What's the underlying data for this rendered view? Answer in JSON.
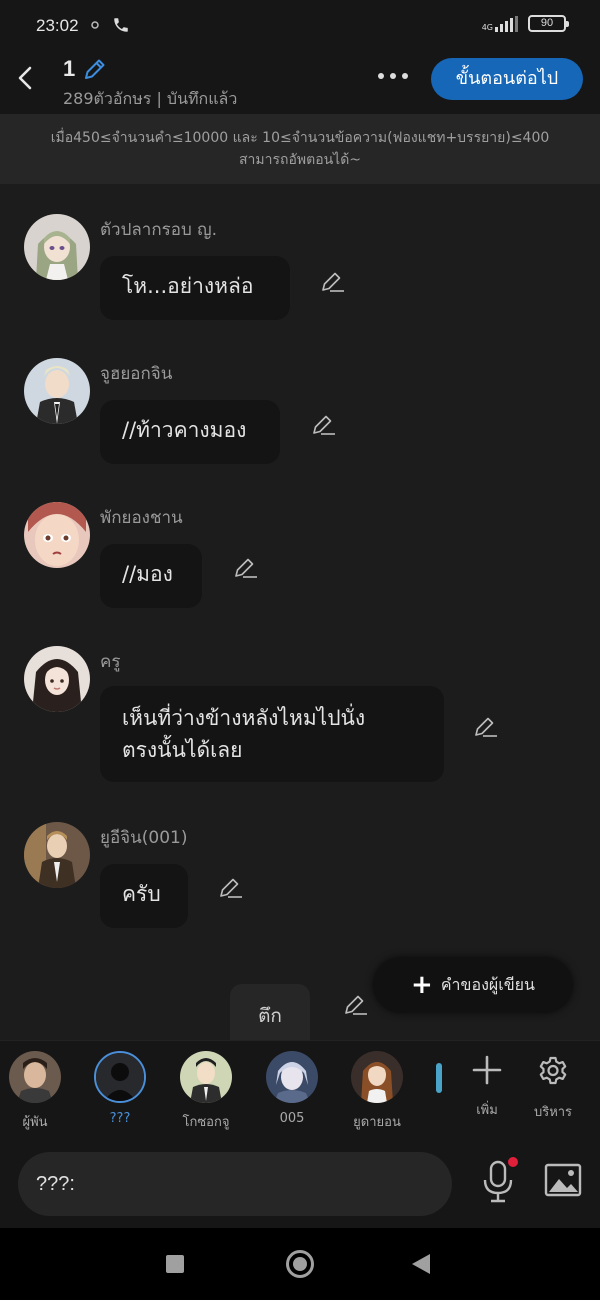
{
  "status_bar": {
    "time": "23:02",
    "network": "4G",
    "battery": "90",
    "icons": [
      "notification-icon",
      "phone-icon",
      "signal-icon",
      "battery-icon"
    ]
  },
  "header": {
    "title": "1",
    "subtitle": "289ตัวอักษร | บันทึกแล้ว",
    "next_label": "ขั้นตอนต่อไป",
    "accent_color": "#1667b8"
  },
  "notice": {
    "line1": "เมื่อ450≤จำนวนคำ≤10000 และ 10≤จำนวนข้อความ(ฟองแชท+บรรยาย)≤400",
    "line2": "สามารถอัพตอนได้~"
  },
  "messages": [
    {
      "sender": "ตัวปลากรอบ ญ.",
      "text": "โห...อย่างหล่อ"
    },
    {
      "sender": "จูฮยอกจิน",
      "text": "//ท้าวคางมอง"
    },
    {
      "sender": "พักยองชาน",
      "text": "//มอง"
    },
    {
      "sender": "ครู",
      "text_line1": "เห็นที่ว่างข้างหลังไหมไปนั่ง",
      "text_line2": "ตรงนั้นได้เลย"
    },
    {
      "sender": "ยูอีจิน(001)",
      "text": "ครับ"
    }
  ],
  "narration": {
    "text": "ตึก"
  },
  "author_button": {
    "label": "คำของผู้เขียน"
  },
  "characters": [
    {
      "name": "ผู้พัน",
      "selected": false
    },
    {
      "name": "???",
      "selected": true
    },
    {
      "name": "โกซอกจู",
      "selected": false
    },
    {
      "name": "005",
      "selected": false
    },
    {
      "name": "ยูดายอน",
      "selected": false
    }
  ],
  "char_actions": {
    "add_label": "เพิ่ม",
    "manage_label": "บริหาร"
  },
  "input": {
    "prefix": "???:"
  }
}
